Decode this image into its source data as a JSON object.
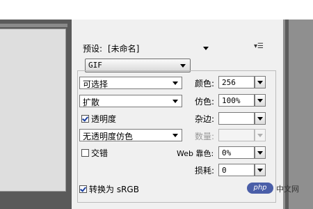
{
  "preset": {
    "label": "预设:",
    "value": "[未命名]"
  },
  "format": {
    "value": "GIF"
  },
  "reduction": {
    "value": "可选择"
  },
  "dither_algorithm": {
    "value": "扩散"
  },
  "transparency": {
    "label": "透明度",
    "checked": true
  },
  "transparency_dither": {
    "value": "无透明度仿色"
  },
  "interlaced": {
    "label": "交错",
    "checked": false
  },
  "colors": {
    "label": "颜色:",
    "value": "256"
  },
  "dither": {
    "label": "仿色:",
    "value": "100%"
  },
  "matte": {
    "label": "杂边:",
    "value": ""
  },
  "amount": {
    "label": "数量:",
    "value": ""
  },
  "web_snap": {
    "label": "Web 靠色:",
    "value": "0%"
  },
  "lossy": {
    "label": "损耗:",
    "value": "0"
  },
  "convert_srgb": {
    "label": "转换为 sRGB",
    "checked": true
  },
  "watermark": {
    "logo": "php",
    "text": "中文网"
  },
  "icons": [
    "panel-menu-icon",
    "dropdown-arrow-icon",
    "checkbox-icon"
  ],
  "colors_theme": {
    "panel_bg": "#f0f0f0",
    "frame_dark": "#5a5a5a",
    "accent": "#4a5ea8"
  }
}
